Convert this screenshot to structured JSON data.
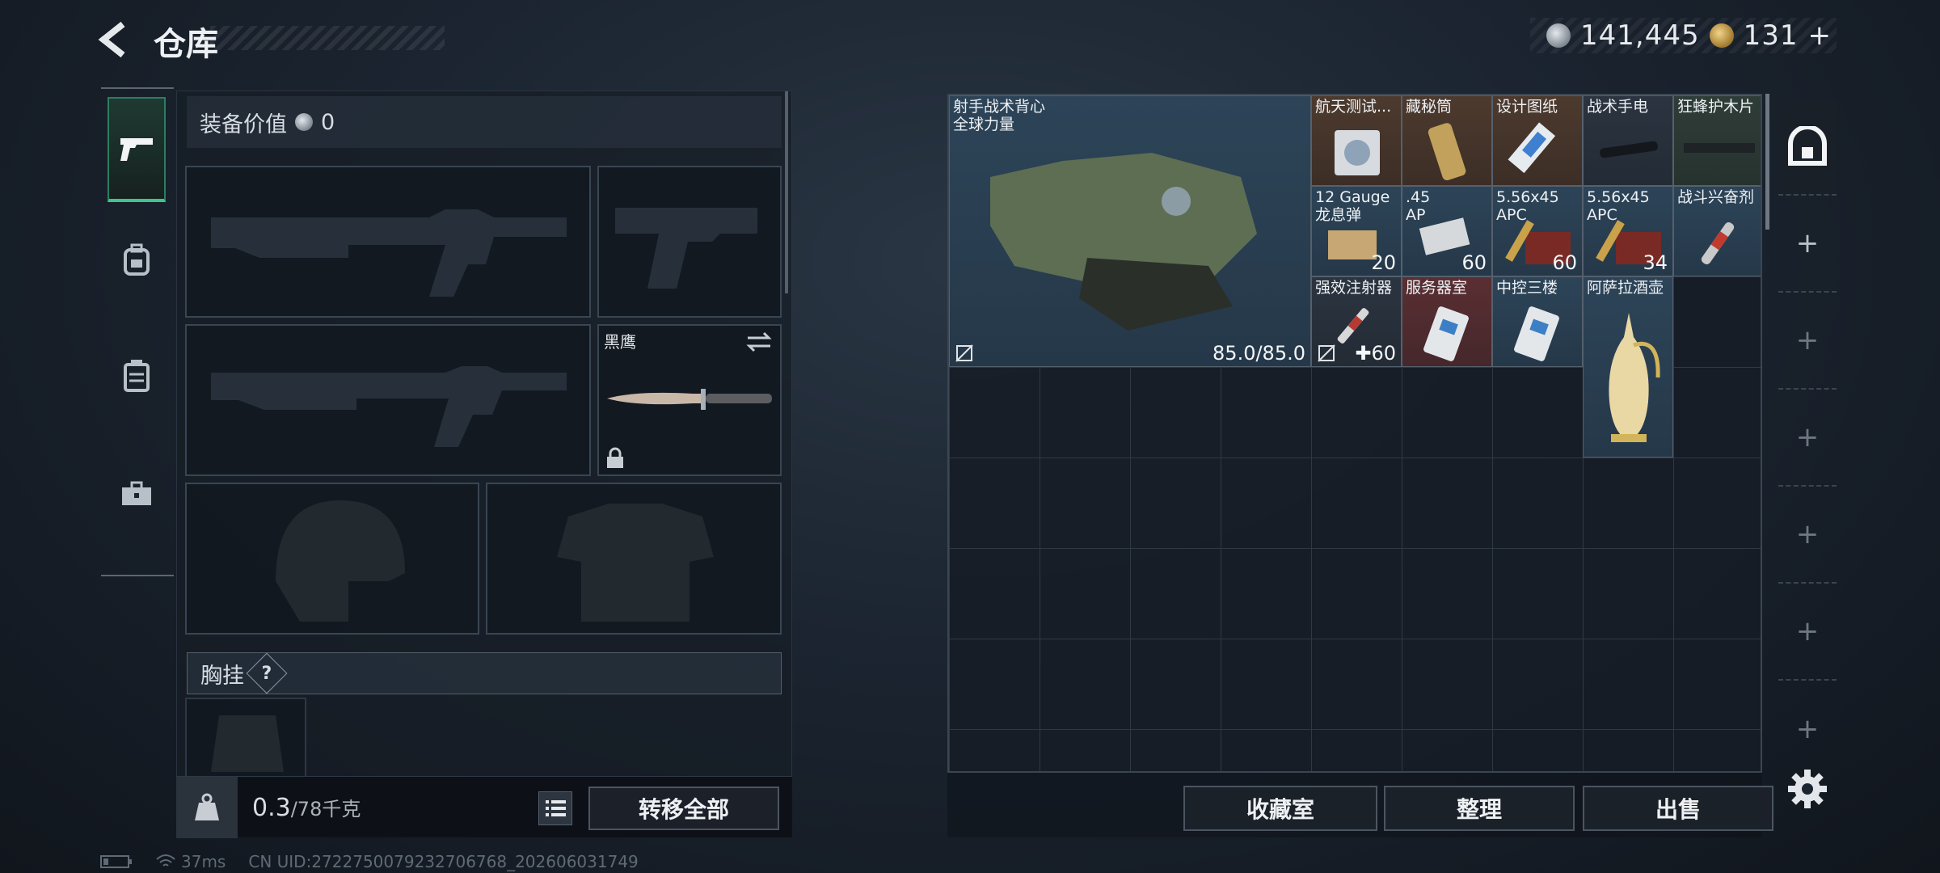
{
  "header": {
    "title": "仓库"
  },
  "currency": {
    "silver": "141,445",
    "gold": "131",
    "add_symbol": "+"
  },
  "left": {
    "equipment_value_label": "装备价值",
    "equipment_value": "0",
    "knife_slot_label": "黑鹰",
    "chest_rig_label": "胸挂",
    "help_symbol": "?",
    "weight_value": "0.3",
    "weight_max": "/78千克",
    "transfer_all": "转移全部"
  },
  "items": [
    {
      "name": "射手战术背心\n全球力量",
      "durability": "85.0/85.0"
    },
    {
      "name": "航天测试..."
    },
    {
      "name": "藏秘筒"
    },
    {
      "name": "设计图纸"
    },
    {
      "name": "战术手电"
    },
    {
      "name": "狂蜂护木片"
    },
    {
      "name": "12 Gauge\n龙息弹",
      "count": "20"
    },
    {
      "name": ".45\nAP",
      "count": "60"
    },
    {
      "name": "5.56x45\nAPC",
      "count": "60"
    },
    {
      "name": "5.56x45\nAPC",
      "count": "34"
    },
    {
      "name": "战斗兴奋剂"
    },
    {
      "name": "强效注射器",
      "count": "60",
      "count_prefix": "✚"
    },
    {
      "name": "服务器室"
    },
    {
      "name": "中控三楼"
    },
    {
      "name": "阿萨拉酒壶"
    }
  ],
  "right_buttons": {
    "collection": "收藏室",
    "sort": "整理",
    "sell": "出售"
  },
  "status": {
    "ping": "37ms",
    "uid": "CN UID:27227500792327067​68_202606031749"
  },
  "icons": [
    "back-icon",
    "silver-coin-icon",
    "gold-coin-icon",
    "pistol-icon",
    "backpack-icon",
    "vest-icon",
    "toolbox-icon",
    "weight-icon",
    "list-icon",
    "safe-box-icon",
    "plus-icon",
    "settings-icon",
    "battery-icon",
    "wifi-icon"
  ]
}
